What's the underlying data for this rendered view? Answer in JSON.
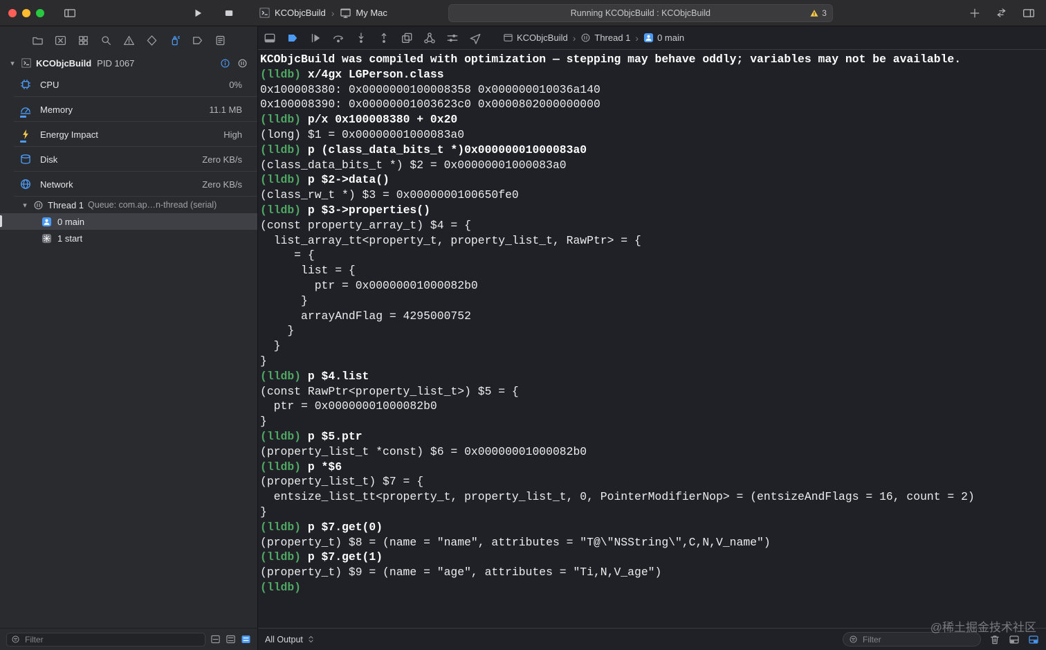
{
  "colors": {
    "accent_blue": "#4B9BF7",
    "prompt_green": "#4FA763",
    "warning_yellow": "#F5C94E",
    "traffic_red": "#FF5F57",
    "traffic_yellow": "#FEBC2E",
    "traffic_green": "#28C840",
    "toolbar_bg": "#2C2C2E",
    "sidebar_bg": "#2A2B2E",
    "console_bg": "#1F2126",
    "selection_bg": "#3E4046"
  },
  "toolbar": {
    "scheme_name": "KCObjcBuild",
    "destination": "My Mac",
    "status_text": "Running KCObjcBuild : KCObjcBuild",
    "warning_count": "3"
  },
  "sidebar": {
    "navigators": [
      "project",
      "source-control",
      "symbol",
      "find",
      "issue",
      "test",
      "debug",
      "breakpoint",
      "report"
    ],
    "active_navigator": "debug",
    "process": {
      "name": "KCObjcBuild",
      "pid_label": "PID 1067"
    },
    "gauges": [
      {
        "label": "CPU",
        "value": "0%",
        "icon": "cpu-icon"
      },
      {
        "label": "Memory",
        "value": "11.1 MB",
        "icon": "memory-icon"
      },
      {
        "label": "Energy Impact",
        "value": "High",
        "icon": "energy-icon"
      },
      {
        "label": "Disk",
        "value": "Zero KB/s",
        "icon": "disk-icon"
      },
      {
        "label": "Network",
        "value": "Zero KB/s",
        "icon": "network-icon"
      }
    ],
    "thread": {
      "name": "Thread 1",
      "queue": "Queue: com.ap…n-thread (serial)"
    },
    "frames": [
      {
        "label": "0 main",
        "icon": "person-icon",
        "selected": true
      },
      {
        "label": "1 start",
        "icon": "gear-icon",
        "selected": false
      }
    ],
    "filter_placeholder": "Filter"
  },
  "debug_bar": {
    "buttons": [
      "hide-debug-area",
      "breakpoints-toggle",
      "continue",
      "step-over",
      "step-into",
      "step-out",
      "debug-view-hierarchy",
      "memory-graph",
      "environment-overrides",
      "simulate-location"
    ],
    "breadcrumb": [
      {
        "label": "KCObjcBuild",
        "icon": "window-icon"
      },
      {
        "label": "Thread 1",
        "icon": "pause-icon"
      },
      {
        "label": "0 main",
        "icon": "person-icon"
      }
    ]
  },
  "console": {
    "prompt": "(lldb)",
    "lines": [
      {
        "type": "warn",
        "text": "KCObjcBuild was compiled with optimization — stepping may behave oddly; variables may not be available."
      },
      {
        "type": "cmd",
        "text": "x/4gx LGPerson.class"
      },
      {
        "type": "out",
        "text": "0x100008380: 0x0000000100008358 0x000000010036a140"
      },
      {
        "type": "out",
        "text": "0x100008390: 0x00000001003623c0 0x0000802000000000"
      },
      {
        "type": "cmd",
        "text": "p/x 0x100008380 + 0x20"
      },
      {
        "type": "out",
        "text": "(long) $1 = 0x00000001000083a0"
      },
      {
        "type": "cmd",
        "text": "p (class_data_bits_t *)0x00000001000083a0"
      },
      {
        "type": "out",
        "text": "(class_data_bits_t *) $2 = 0x00000001000083a0"
      },
      {
        "type": "cmd",
        "text": "p $2->data()"
      },
      {
        "type": "out",
        "text": "(class_rw_t *) $3 = 0x0000000100650fe0"
      },
      {
        "type": "cmd",
        "text": "p $3->properties()"
      },
      {
        "type": "out",
        "text": "(const property_array_t) $4 = {"
      },
      {
        "type": "out",
        "text": "  list_array_tt<property_t, property_list_t, RawPtr> = {"
      },
      {
        "type": "out",
        "text": "     = {"
      },
      {
        "type": "out",
        "text": "      list = {"
      },
      {
        "type": "out",
        "text": "        ptr = 0x00000001000082b0"
      },
      {
        "type": "out",
        "text": "      }"
      },
      {
        "type": "out",
        "text": "      arrayAndFlag = 4295000752"
      },
      {
        "type": "out",
        "text": "    }"
      },
      {
        "type": "out",
        "text": "  }"
      },
      {
        "type": "out",
        "text": "}"
      },
      {
        "type": "cmd",
        "text": "p $4.list"
      },
      {
        "type": "out",
        "text": "(const RawPtr<property_list_t>) $5 = {"
      },
      {
        "type": "out",
        "text": "  ptr = 0x00000001000082b0"
      },
      {
        "type": "out",
        "text": "}"
      },
      {
        "type": "cmd",
        "text": "p $5.ptr"
      },
      {
        "type": "out",
        "text": "(property_list_t *const) $6 = 0x00000001000082b0"
      },
      {
        "type": "cmd",
        "text": "p *$6"
      },
      {
        "type": "out",
        "text": "(property_list_t) $7 = {"
      },
      {
        "type": "out",
        "text": "  entsize_list_tt<property_t, property_list_t, 0, PointerModifierNop> = (entsizeAndFlags = 16, count = 2)"
      },
      {
        "type": "out",
        "text": "}"
      },
      {
        "type": "cmd",
        "text": "p $7.get(0)"
      },
      {
        "type": "out",
        "text": "(property_t) $8 = (name = \"name\", attributes = \"T@\\\"NSString\\\",C,N,V_name\")"
      },
      {
        "type": "cmd",
        "text": "p $7.get(1)"
      },
      {
        "type": "out",
        "text": "(property_t) $9 = (name = \"age\", attributes = \"Ti,N,V_age\")"
      },
      {
        "type": "prompt",
        "text": ""
      }
    ],
    "bottom": {
      "scope_label": "All Output",
      "filter_placeholder": "Filter"
    }
  },
  "watermark": "@稀土掘金技术社区"
}
